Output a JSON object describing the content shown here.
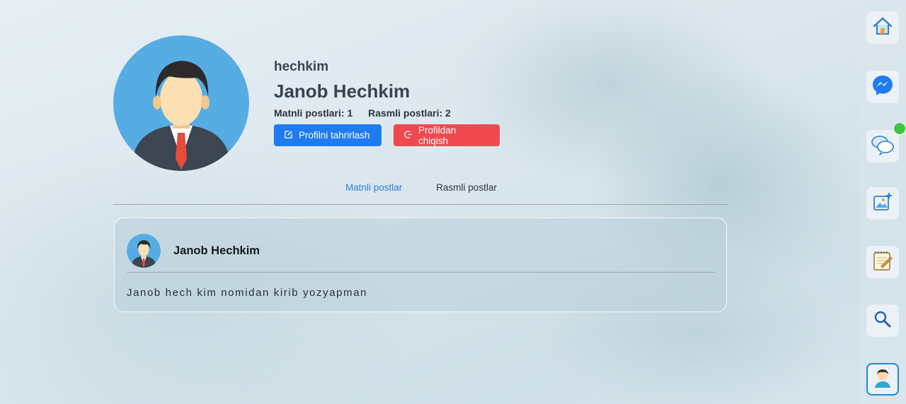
{
  "profile": {
    "username": "hechkim",
    "full_name": "Janob Hechkim",
    "text_posts_label": "Matnli postlari: 1",
    "image_posts_label": "Rasmli postlari: 2",
    "edit_button": "Profilni tahrirlash",
    "logout_button": "Profildan chiqish"
  },
  "tabs": [
    {
      "label": "Matnli postlar",
      "active": true
    },
    {
      "label": "Rasmli postlar",
      "active": false
    }
  ],
  "post": {
    "author": "Janob Hechkim",
    "text": "Janob hech kim nomidan kirib yozyapman"
  },
  "sidebar": {
    "items": [
      {
        "icon": "home-icon"
      },
      {
        "icon": "messenger-icon"
      },
      {
        "icon": "chat-bubbles-icon",
        "online": true
      },
      {
        "icon": "add-image-icon"
      },
      {
        "icon": "notepad-icon"
      },
      {
        "icon": "search-icon"
      },
      {
        "icon": "profile-avatar-icon"
      }
    ]
  },
  "colors": {
    "primary": "#1e7bf0",
    "danger": "#f0484f",
    "active_tab": "#2a7fd4",
    "online": "#3ec43e"
  }
}
